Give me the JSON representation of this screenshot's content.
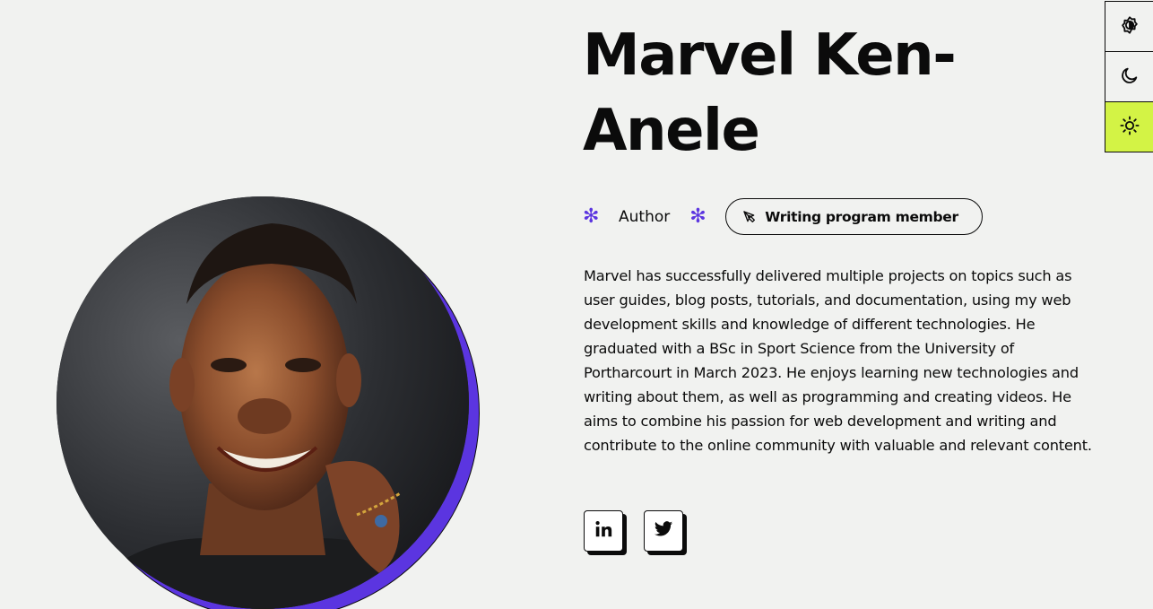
{
  "profile": {
    "name": "Marvel Ken-Anele",
    "role": "Author",
    "badge_label": "Writing program member",
    "bio": "Marvel has successfully delivered multiple projects on topics such as user guides, blog posts, tutorials, and documentation, using my web development skills and knowledge of different technologies. He graduated with a BSc in Sport Science from the University of Portharcourt in March 2023. He enjoys learning new technologies and writing about them, as well as programming and creating videos. He aims to combine his passion for web development and writing and contribute to the online community with valuable and relevant content."
  },
  "decorations": {
    "asterisk_glyph": "✻",
    "accent_color": "#5b35e0",
    "active_theme_color": "#d3f345"
  },
  "socials": [
    {
      "icon": "linkedin-icon"
    },
    {
      "icon": "twitter-icon"
    }
  ],
  "theme_switcher": {
    "options": [
      {
        "icon": "auto-contrast-icon",
        "active": false
      },
      {
        "icon": "moon-icon",
        "active": false
      },
      {
        "icon": "sun-icon",
        "active": true
      }
    ]
  }
}
